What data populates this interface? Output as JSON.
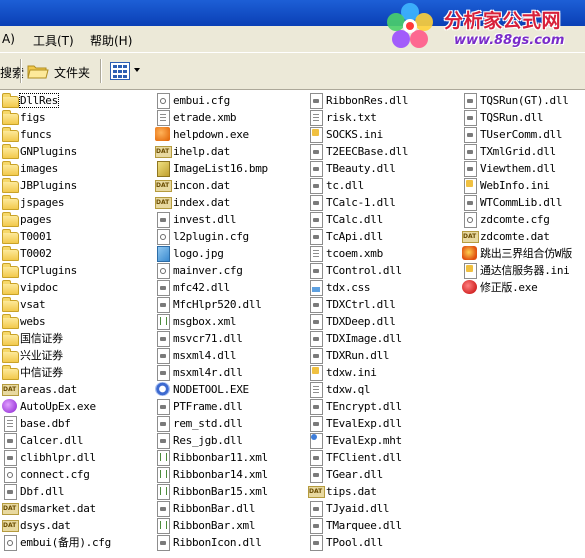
{
  "menu": {
    "view_label": "A)",
    "tools_label": "工具(T)",
    "help_label": "帮助(H)"
  },
  "toolbar": {
    "search_label": "搜索",
    "folders_label": "文件夹"
  },
  "watermark": {
    "brand": "分析家公式网",
    "url": "www.88gs.com"
  },
  "colors": {
    "titlebar": "#0a3fb5",
    "menubar_bg": "#ece9d8",
    "brand_red": "#d8203a",
    "url_purple": "#7a2cc9"
  },
  "columns": [
    [
      {
        "name": "DllRes",
        "icon": "folder",
        "selected": true
      },
      {
        "name": "figs",
        "icon": "folder"
      },
      {
        "name": "funcs",
        "icon": "folder"
      },
      {
        "name": "GNPlugins",
        "icon": "folder"
      },
      {
        "name": "images",
        "icon": "folder"
      },
      {
        "name": "JBPlugins",
        "icon": "folder"
      },
      {
        "name": "jspages",
        "icon": "folder"
      },
      {
        "name": "pages",
        "icon": "folder"
      },
      {
        "name": "T0001",
        "icon": "folder"
      },
      {
        "name": "T0002",
        "icon": "folder"
      },
      {
        "name": "TCPlugins",
        "icon": "folder"
      },
      {
        "name": "vipdoc",
        "icon": "folder"
      },
      {
        "name": "vsat",
        "icon": "folder"
      },
      {
        "name": "webs",
        "icon": "folder"
      },
      {
        "name": "国信证券",
        "icon": "folder"
      },
      {
        "name": "兴业证券",
        "icon": "folder"
      },
      {
        "name": "中信证券",
        "icon": "folder"
      },
      {
        "name": "areas.dat",
        "icon": "dat"
      },
      {
        "name": "AutoUpEx.exe",
        "icon": "exe-purple"
      },
      {
        "name": "base.dbf",
        "icon": "file"
      },
      {
        "name": "Calcer.dll",
        "icon": "dll"
      },
      {
        "name": "clibhlpr.dll",
        "icon": "dll"
      },
      {
        "name": "connect.cfg",
        "icon": "cfg"
      },
      {
        "name": "Dbf.dll",
        "icon": "dll"
      },
      {
        "name": "dsmarket.dat",
        "icon": "dat"
      },
      {
        "name": "dsys.dat",
        "icon": "dat"
      },
      {
        "name": "embui(备用).cfg",
        "icon": "cfg"
      }
    ],
    [
      {
        "name": "embui.cfg",
        "icon": "cfg"
      },
      {
        "name": "etrade.xmb",
        "icon": "file"
      },
      {
        "name": "helpdown.exe",
        "icon": "exe-orange"
      },
      {
        "name": "ihelp.dat",
        "icon": "dat"
      },
      {
        "name": "ImageList16.bmp",
        "icon": "gif"
      },
      {
        "name": "incon.dat",
        "icon": "dat"
      },
      {
        "name": "index.dat",
        "icon": "dat"
      },
      {
        "name": "invest.dll",
        "icon": "dll"
      },
      {
        "name": "l2plugin.cfg",
        "icon": "cfg"
      },
      {
        "name": "logo.jpg",
        "icon": "img"
      },
      {
        "name": "mainver.cfg",
        "icon": "cfg"
      },
      {
        "name": "mfc42.dll",
        "icon": "dll"
      },
      {
        "name": "MfcHlpr520.dll",
        "icon": "dll"
      },
      {
        "name": "msgbox.xml",
        "icon": "xml"
      },
      {
        "name": "msvcr71.dll",
        "icon": "dll"
      },
      {
        "name": "msxml4.dll",
        "icon": "dll"
      },
      {
        "name": "msxml4r.dll",
        "icon": "dll"
      },
      {
        "name": "NODETOOL.EXE",
        "icon": "exe-gear"
      },
      {
        "name": "PTFrame.dll",
        "icon": "dll"
      },
      {
        "name": "rem_std.dll",
        "icon": "dll"
      },
      {
        "name": "Res_jgb.dll",
        "icon": "dll"
      },
      {
        "name": "Ribbonbar11.xml",
        "icon": "xml"
      },
      {
        "name": "Ribbonbar14.xml",
        "icon": "xml"
      },
      {
        "name": "RibbonBar15.xml",
        "icon": "xml"
      },
      {
        "name": "RibbonBar.dll",
        "icon": "dll"
      },
      {
        "name": "RibbonBar.xml",
        "icon": "xml"
      },
      {
        "name": "RibbonIcon.dll",
        "icon": "dll"
      }
    ],
    [
      {
        "name": "RibbonRes.dll",
        "icon": "dll"
      },
      {
        "name": "risk.txt",
        "icon": "file"
      },
      {
        "name": "SOCKS.ini",
        "icon": "ini"
      },
      {
        "name": "T2EECBase.dll",
        "icon": "dll"
      },
      {
        "name": "TBeauty.dll",
        "icon": "dll"
      },
      {
        "name": "tc.dll",
        "icon": "dll"
      },
      {
        "name": "TCalc-1.dll",
        "icon": "dll"
      },
      {
        "name": "TCalc.dll",
        "icon": "dll"
      },
      {
        "name": "TcApi.dll",
        "icon": "dll"
      },
      {
        "name": "tcoem.xmb",
        "icon": "file"
      },
      {
        "name": "TControl.dll",
        "icon": "dll"
      },
      {
        "name": "tdx.css",
        "icon": "css"
      },
      {
        "name": "TDXCtrl.dll",
        "icon": "dll"
      },
      {
        "name": "TDXDeep.dll",
        "icon": "dll"
      },
      {
        "name": "TDXImage.dll",
        "icon": "dll"
      },
      {
        "name": "TDXRun.dll",
        "icon": "dll"
      },
      {
        "name": "tdxw.ini",
        "icon": "ini"
      },
      {
        "name": "tdxw.ql",
        "icon": "file"
      },
      {
        "name": "TEncrypt.dll",
        "icon": "dll"
      },
      {
        "name": "TEvalExp.dll",
        "icon": "dll"
      },
      {
        "name": "TEvalExp.mht",
        "icon": "mht"
      },
      {
        "name": "TFClient.dll",
        "icon": "dll"
      },
      {
        "name": "TGear.dll",
        "icon": "dll"
      },
      {
        "name": "tips.dat",
        "icon": "dat"
      },
      {
        "name": "TJyaid.dll",
        "icon": "dll"
      },
      {
        "name": "TMarquee.dll",
        "icon": "dll"
      },
      {
        "name": "TPool.dll",
        "icon": "dll"
      }
    ],
    [
      {
        "name": "TQSRun(GT).dll",
        "icon": "dll"
      },
      {
        "name": "TQSRun.dll",
        "icon": "dll"
      },
      {
        "name": "TUserComm.dll",
        "icon": "dll"
      },
      {
        "name": "TXmlGrid.dll",
        "icon": "dll"
      },
      {
        "name": "Viewthem.dll",
        "icon": "dll"
      },
      {
        "name": "WebInfo.ini",
        "icon": "ini"
      },
      {
        "name": "WTCommLib.dll",
        "icon": "dll"
      },
      {
        "name": "zdcomte.cfg",
        "icon": "cfg"
      },
      {
        "name": "zdcomte.dat",
        "icon": "dat"
      },
      {
        "name": "跳出三界组合仿W版",
        "icon": "app"
      },
      {
        "name": "通达信服务器.ini",
        "icon": "ini"
      },
      {
        "name": "修正版.exe",
        "icon": "exe-red"
      }
    ]
  ]
}
